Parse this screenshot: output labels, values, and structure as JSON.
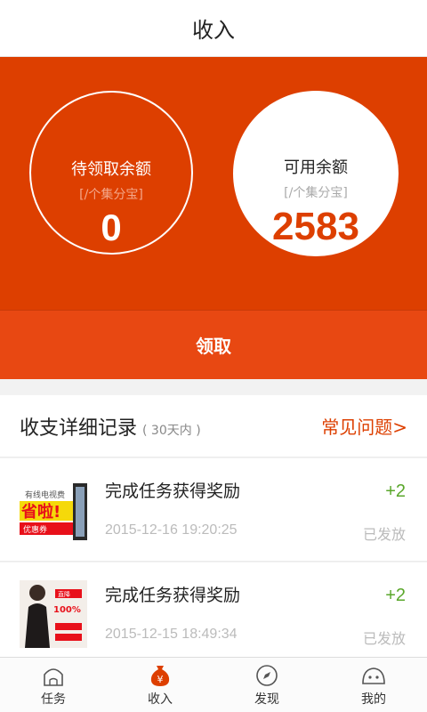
{
  "header": {
    "title": "收入"
  },
  "balances": {
    "pending": {
      "title": "待领取余额",
      "unit": "[/个集分宝]",
      "value": "0"
    },
    "available": {
      "title": "可用余额",
      "unit": "[/个集分宝]",
      "value": "2583"
    }
  },
  "claim_button": {
    "label": "领取"
  },
  "records": {
    "title": "收支详细记录",
    "subtitle": "( 30天内 )",
    "faq_link": "常见问题>",
    "items": [
      {
        "title": "完成任务获得奖励",
        "time": "2015-12-16 19:20:25",
        "amount": "+2",
        "status": "已发放",
        "thumb_icon": "tv-bill-ad-thumbnail"
      },
      {
        "title": "完成任务获得奖励",
        "time": "2015-12-15 18:49:34",
        "amount": "+2",
        "status": "已发放",
        "thumb_icon": "fashion-ad-thumbnail"
      }
    ]
  },
  "tabbar": {
    "items": [
      {
        "label": "任务",
        "icon": "house-icon",
        "active": false
      },
      {
        "label": "收入",
        "icon": "money-bag-icon",
        "active": true
      },
      {
        "label": "发现",
        "icon": "compass-icon",
        "active": false
      },
      {
        "label": "我的",
        "icon": "smiley-icon",
        "active": false
      }
    ]
  },
  "colors": {
    "accent": "#dd3f00",
    "button": "#e84812",
    "positive": "#5aa72b"
  }
}
